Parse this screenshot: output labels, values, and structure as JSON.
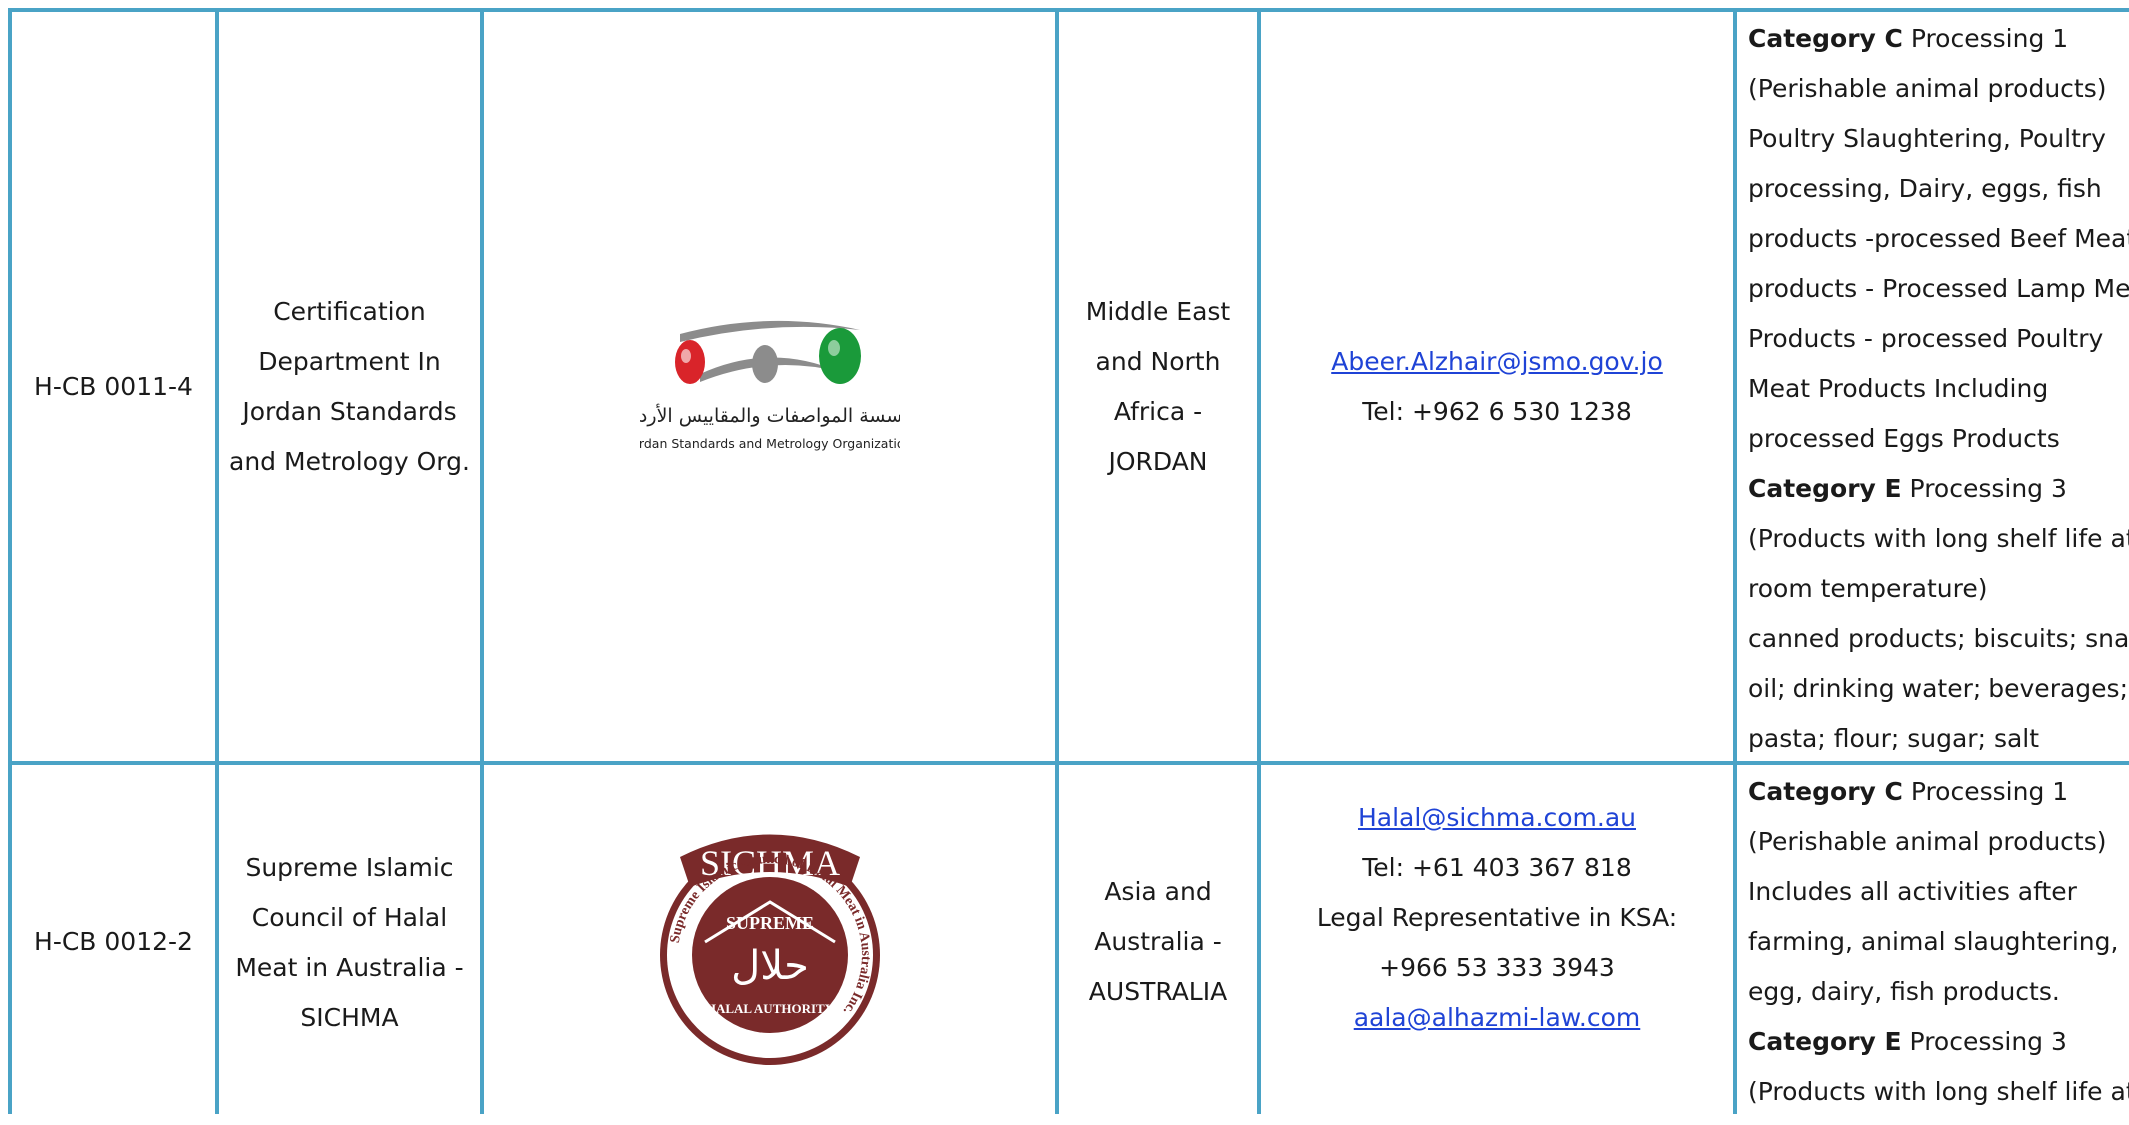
{
  "rows": [
    {
      "code": "H-CB 0011-4",
      "name_lines": [
        "Certification",
        "Department In",
        "Jordan Standards",
        "and Metrology Org."
      ],
      "logo": {
        "arabic_text": "مؤسسة المواصفات والمقاييس الأردنية",
        "english_text": "Jordan Standards and Metrology Organization"
      },
      "region_lines": [
        "Middle East",
        "and North",
        "Africa -",
        "JORDAN"
      ],
      "contact": {
        "email": "Abeer.Alzhair@jsmo.gov.jo",
        "tel": "Tel: +962 6 530 1238"
      },
      "scope": {
        "cat_c_label": "Category C",
        "cat_c_rest": " Processing 1",
        "c_lines": [
          "(Perishable animal products)",
          "Poultry Slaughtering, Poultry",
          "processing, Dairy, eggs, fish",
          "products -processed Beef Meat",
          "products - Processed Lamp Meat",
          "Products - processed Poultry",
          "Meat Products Including",
          "processed Eggs Products"
        ],
        "cat_e_label": "Category E",
        "cat_e_rest": " Processing 3",
        "e_lines": [
          "(Products with long shelf life at",
          "room temperature)",
          "canned products; biscuits; snacks;"
        ],
        "e_justify": [
          "oil;",
          "drinking",
          "water;",
          "beverages;"
        ],
        "e_last": "pasta; flour; sugar; salt"
      }
    },
    {
      "code": "H-CB 0012-2",
      "name_lines": [
        "Supreme Islamic",
        "Council of Halal",
        "Meat in Australia -",
        "SICHMA"
      ],
      "logo": {
        "top_text": "SICHMA",
        "ring_text": "Supreme Islamic Council of Halal Meat in Australia Inc.",
        "band_text": "SUPREME",
        "center_text": "حلال",
        "bottom_text": "HALAL AUTHORITY"
      },
      "region_lines": [
        "Asia and",
        "Australia -",
        "AUSTRALIA"
      ],
      "contact": {
        "email": "Halal@sichma.com.au",
        "tel": "Tel: +61 403 367 818",
        "rep_label": "Legal Representative in KSA:",
        "rep_phone": "+966 53 333 3943",
        "rep_email": "aala@alhazmi-law.com"
      },
      "scope": {
        "cat_c_label": "Category C",
        "cat_c_rest": " Processing 1",
        "c_lines": [
          "(Perishable animal products)",
          "Includes all activities after",
          "farming, animal slaughtering,",
          "egg, dairy, fish products."
        ],
        "cat_e_label": "Category E",
        "cat_e_rest": " Processing 3",
        "e_lines": [
          "(Products with long shelf life at"
        ]
      }
    }
  ],
  "colors": {
    "border": "#4aa3c6",
    "link": "#1f43d6",
    "jsmo_red": "#d9242a",
    "jsmo_grey": "#8c8c8c",
    "jsmo_green": "#1a9a3a",
    "sichma_maroon": "#7a2a2a"
  }
}
